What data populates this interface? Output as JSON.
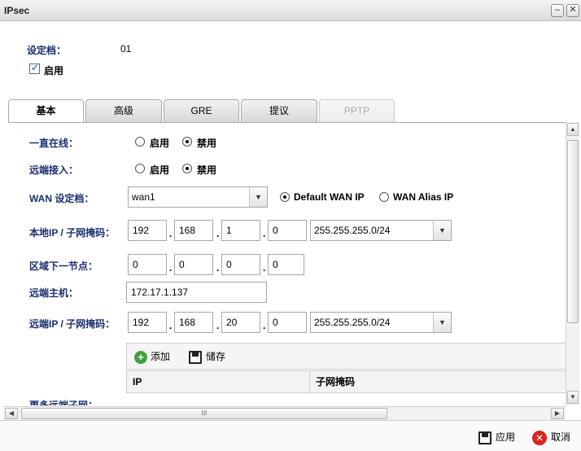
{
  "window": {
    "title": "IPsec"
  },
  "profile": {
    "label": "设定档：",
    "value": "01",
    "enable_label": "启用",
    "enabled": true
  },
  "tabs": [
    {
      "label": "基本",
      "state": "active"
    },
    {
      "label": "高级",
      "state": "normal"
    },
    {
      "label": "GRE",
      "state": "normal"
    },
    {
      "label": "提议",
      "state": "normal"
    },
    {
      "label": "PPTP",
      "state": "disabled"
    }
  ],
  "form": {
    "always_online": {
      "label": "一直在线：",
      "options": [
        "启用",
        "禁用"
      ],
      "selected": "禁用"
    },
    "remote_access": {
      "label": "远端接入：",
      "options": [
        "启用",
        "禁用"
      ],
      "selected": "禁用"
    },
    "wan_profile": {
      "label": "WAN 设定档：",
      "value": "wan1",
      "options": [
        "Default WAN IP",
        "WAN Alias IP"
      ],
      "selected": "Default WAN IP"
    },
    "local_ip": {
      "label": "本地IP / 子网掩码：",
      "octets": [
        "192",
        "168",
        "1",
        "0"
      ],
      "mask": "255.255.255.0/24"
    },
    "next_hop": {
      "label": "区域下一节点：",
      "octets": [
        "0",
        "0",
        "0",
        "0"
      ]
    },
    "remote_host": {
      "label": "远端主机：",
      "value": "172.17.1.137"
    },
    "remote_ip": {
      "label": "远端IP / 子网掩码：",
      "octets": [
        "192",
        "168",
        "20",
        "0"
      ],
      "mask": "255.255.255.0/24"
    },
    "more_remote_subnets": {
      "label": "更多远端子网："
    }
  },
  "subnet_table": {
    "add_label": "添加",
    "save_label": "储存",
    "columns": [
      "IP",
      "子网掩码"
    ]
  },
  "footer": {
    "apply_label": "应用",
    "cancel_label": "取消"
  }
}
